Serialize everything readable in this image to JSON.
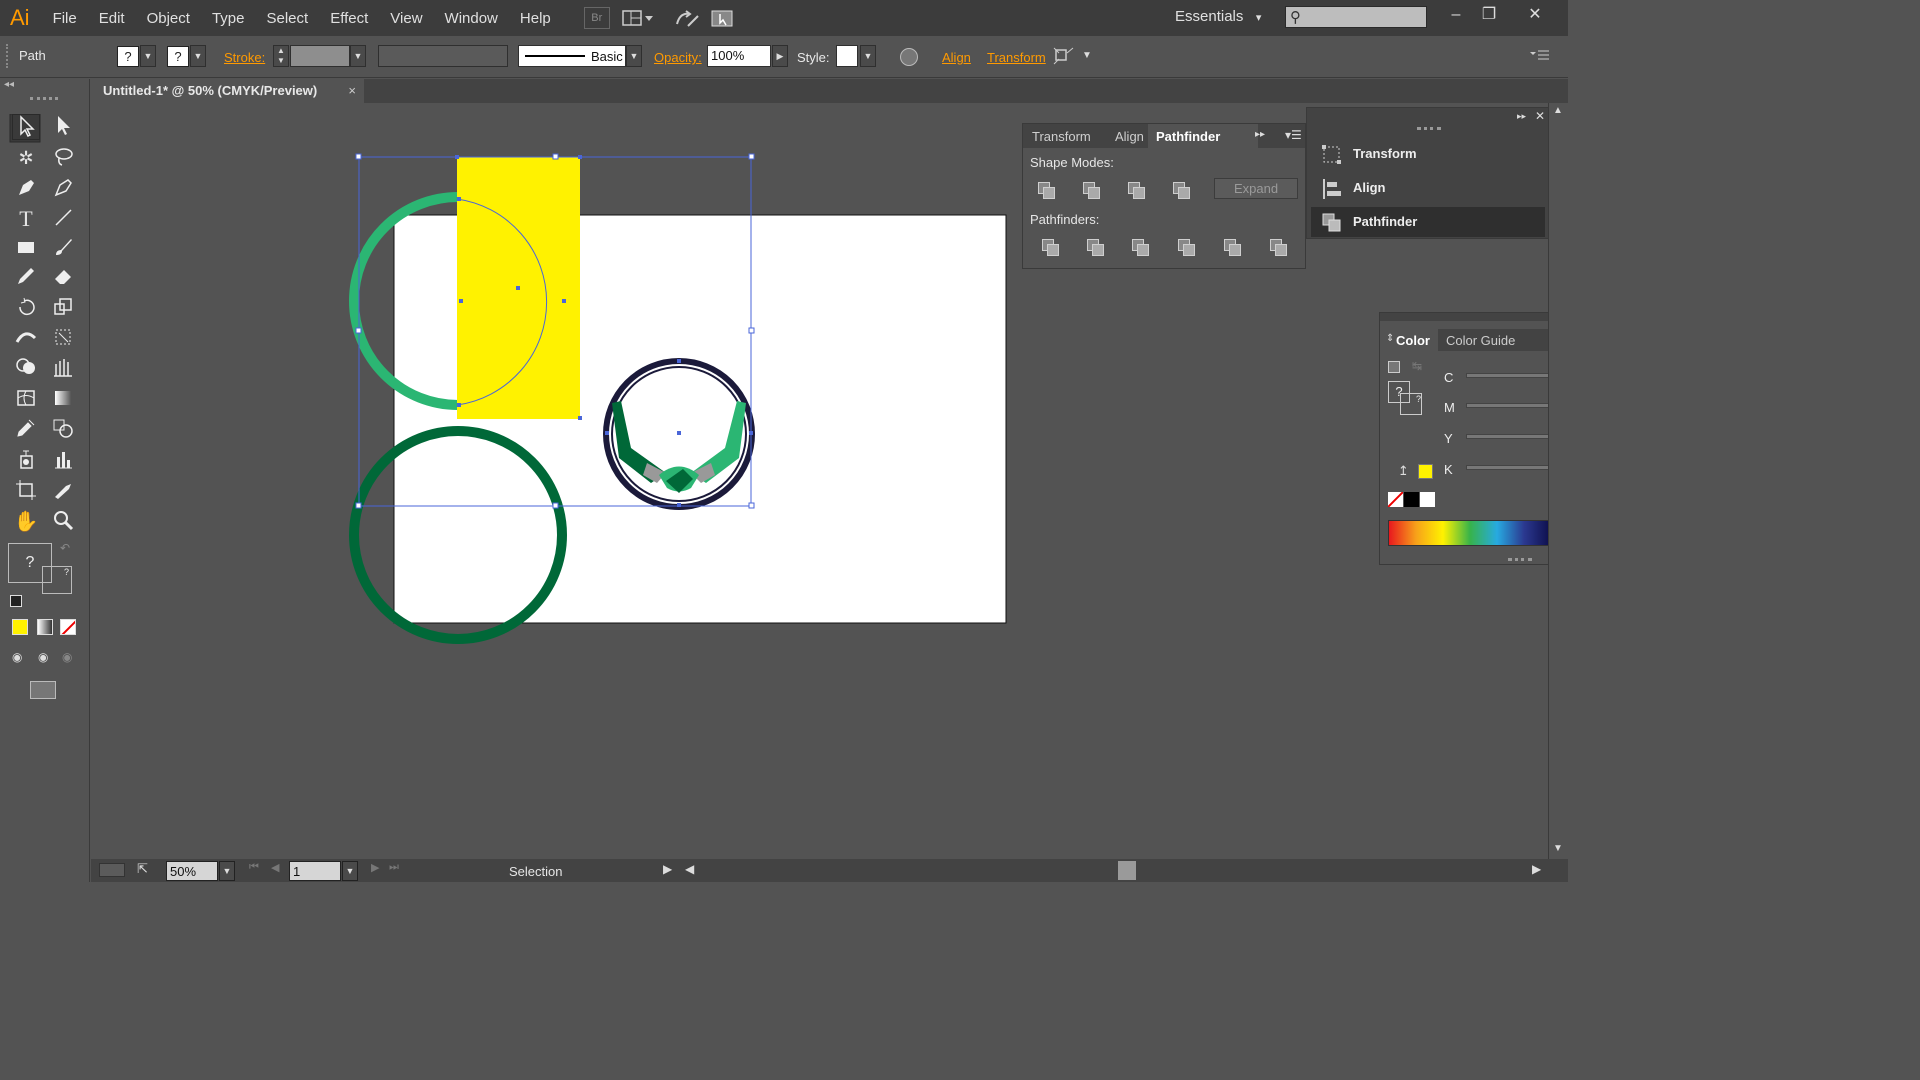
{
  "app": {
    "logo": "Ai"
  },
  "menu": [
    "File",
    "Edit",
    "Object",
    "Type",
    "Select",
    "Effect",
    "View",
    "Window",
    "Help"
  ],
  "menubar_icons": {
    "bridge": "Br",
    "arrange": "arrange-documents-icon",
    "sync": "sync-icon",
    "gpu": "gpu-preview-icon"
  },
  "workspace": {
    "label": "Essentials",
    "arrow": "▾"
  },
  "search": {
    "placeholder": "",
    "icon": "search-icon"
  },
  "window_controls": {
    "minimize": "–",
    "restore": "❐",
    "close": "✕"
  },
  "control_bar": {
    "selection_type": "Path",
    "fill_value": "?",
    "stroke_swatch": "?",
    "stroke_label": "Stroke:",
    "brush_label": "Basic",
    "opacity_label": "Opacity:",
    "opacity_value": "100%",
    "style_label": "Style:",
    "align_link": "Align",
    "transform_link": "Transform"
  },
  "document_tab": {
    "title": "Untitled-1* @ 50% (CMYK/Preview)",
    "close": "×"
  },
  "pathfinder_panel": {
    "tabs": [
      "Transform",
      "Align",
      "Pathfinder"
    ],
    "active_tab": "Pathfinder",
    "shape_modes_label": "Shape Modes:",
    "expand_label": "Expand",
    "pathfinders_label": "Pathfinders:"
  },
  "collapsed_panels": {
    "items": [
      {
        "label": "Transform",
        "icon": "transform-icon"
      },
      {
        "label": "Align",
        "icon": "align-icon"
      },
      {
        "label": "Pathfinder",
        "icon": "pathfinder-icon"
      }
    ],
    "active": "Pathfinder"
  },
  "color_panel": {
    "tabs": [
      "Color",
      "Color Guide"
    ],
    "active_tab": "Color",
    "channels": [
      "C",
      "M",
      "Y",
      "K"
    ],
    "fill_color": "#fff200"
  },
  "toolbox": {
    "fill_question": "?",
    "stroke_question": "?"
  },
  "status_bar": {
    "zoom": "50%",
    "page": "1",
    "tool_status": "Selection"
  },
  "colors": {
    "yellow": "#fff200",
    "light_green": "#2bb673",
    "dark_green": "#006838",
    "navy": "#1b1a3a",
    "selection": "#4a66d8"
  }
}
